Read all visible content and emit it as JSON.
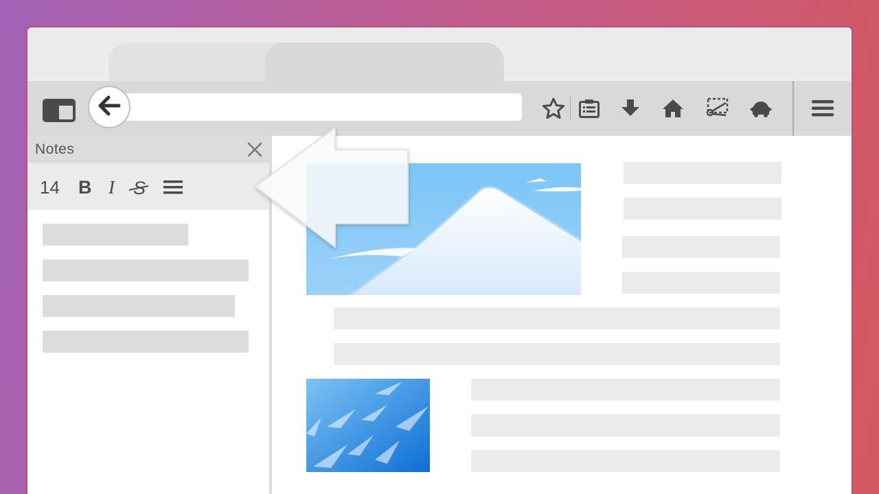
{
  "browser": {
    "toolbar": {
      "icons": [
        "sidebar-icon",
        "back-arrow-icon",
        "star-icon",
        "reading-list-icon",
        "download-icon",
        "home-icon",
        "screenshot-icon",
        "tracking-icon",
        "hamburger-menu-icon"
      ]
    }
  },
  "notes_panel": {
    "title": "Notes",
    "format_bar": {
      "font_size": "14",
      "bold_label": "B",
      "italic_label": "I",
      "strike_label": "S"
    }
  },
  "colors": {
    "background_start": "#a262b6",
    "background_end": "#d3585f",
    "toolbar": "#d9d9d9",
    "icon": "#4a4a4a",
    "placeholder": "#dcdcdc"
  }
}
